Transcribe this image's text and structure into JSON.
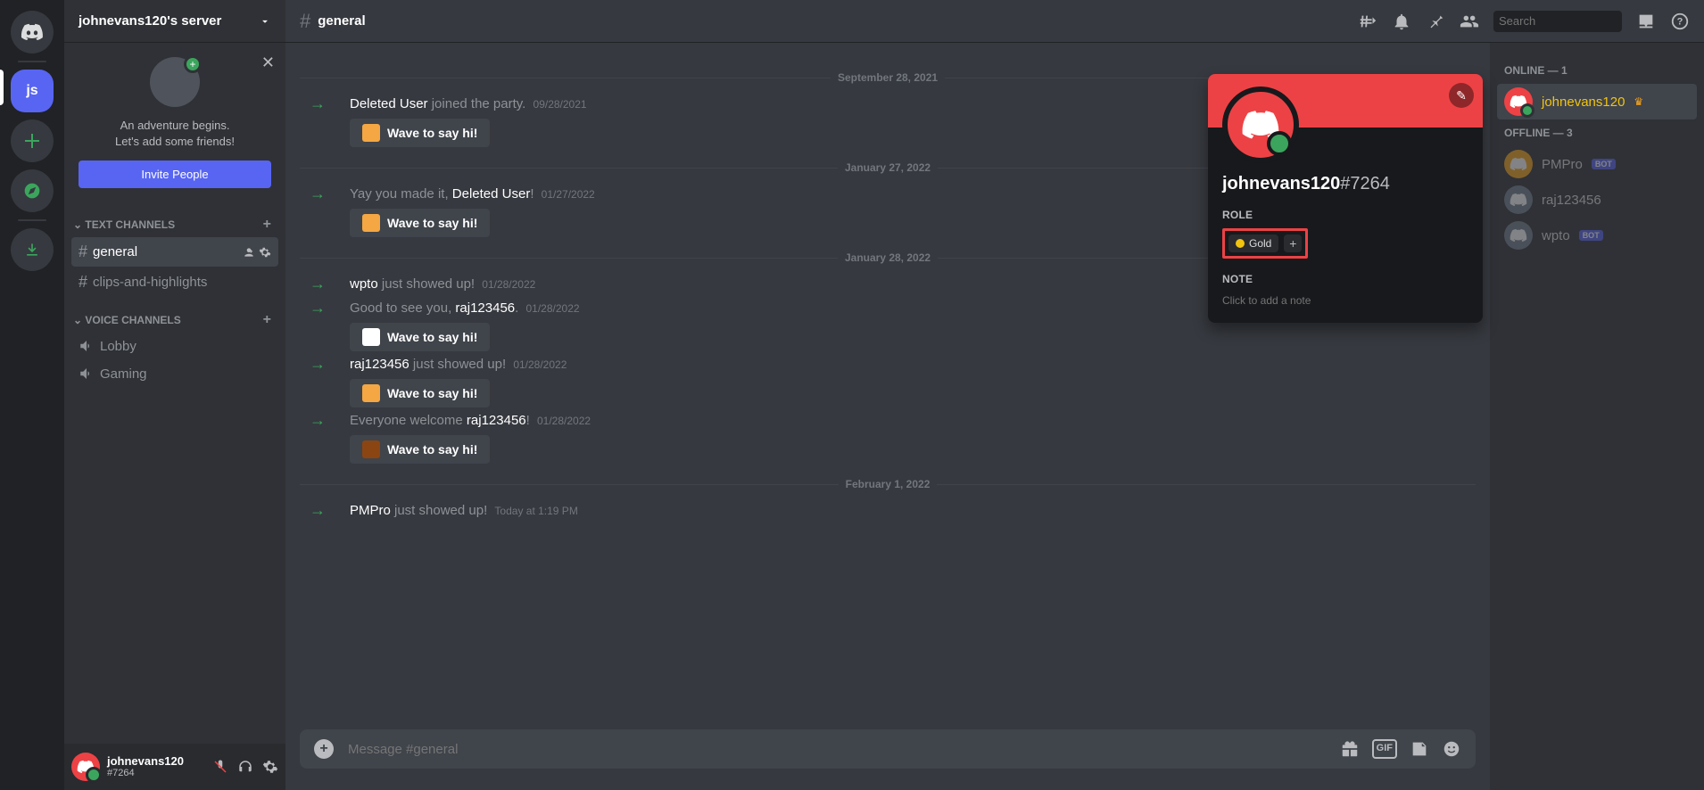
{
  "server_rail": {
    "active_initials": "js"
  },
  "sidebar": {
    "server_name": "johnevans120's server",
    "invite": {
      "line1": "An adventure begins.",
      "line2": "Let's add some friends!",
      "button": "Invite People"
    },
    "sections": {
      "text_label": "Text Channels",
      "voice_label": "Voice Channels"
    },
    "text_channels": [
      {
        "name": "general",
        "active": true
      },
      {
        "name": "clips-and-highlights",
        "active": false
      }
    ],
    "voice_channels": [
      {
        "name": "Lobby"
      },
      {
        "name": "Gaming"
      }
    ],
    "user": {
      "name": "johnevans120",
      "tag": "#7264"
    }
  },
  "topbar": {
    "channel": "general",
    "search_placeholder": "Search"
  },
  "dividers": {
    "d1": "September 28, 2021",
    "d2": "January 27, 2022",
    "d3": "January 28, 2022",
    "d4": "February 1, 2022"
  },
  "wave": {
    "label": "Wave to say hi!"
  },
  "messages": {
    "m1": {
      "user": "Deleted User",
      "text": " joined the party.",
      "ts": "09/28/2021"
    },
    "m2": {
      "pre": "Yay you made it, ",
      "user": "Deleted User",
      "post": "!",
      "ts": "01/27/2022"
    },
    "m3": {
      "user": "wpto",
      "text": " just showed up!",
      "ts": "01/28/2022"
    },
    "m4": {
      "pre": "Good to see you, ",
      "user": "raj123456",
      "post": ".",
      "ts": "01/28/2022"
    },
    "m5": {
      "user": "raj123456",
      "text": " just showed up!",
      "ts": "01/28/2022"
    },
    "m6": {
      "pre": "Everyone welcome ",
      "user": "raj123456",
      "post": "!",
      "ts": "01/28/2022"
    },
    "m7": {
      "user": "PMPro",
      "text": " just showed up!",
      "ts": "Today at 1:19 PM"
    }
  },
  "composer": {
    "placeholder": "Message #general"
  },
  "members": {
    "online_header": "Online — 1",
    "offline_header": "Offline — 3",
    "online": [
      {
        "name": "johnevans120",
        "crown": true
      }
    ],
    "offline": [
      {
        "name": "PMPro",
        "bot": true
      },
      {
        "name": "raj123456",
        "bot": false
      },
      {
        "name": "wpto",
        "bot": true
      }
    ]
  },
  "popover": {
    "username": "johnevans120",
    "discrim": "#7264",
    "role_label": "ROLE",
    "role_name": "Gold",
    "note_label": "NOTE",
    "note_placeholder": "Click to add a note"
  },
  "bot_tag": "BOT"
}
